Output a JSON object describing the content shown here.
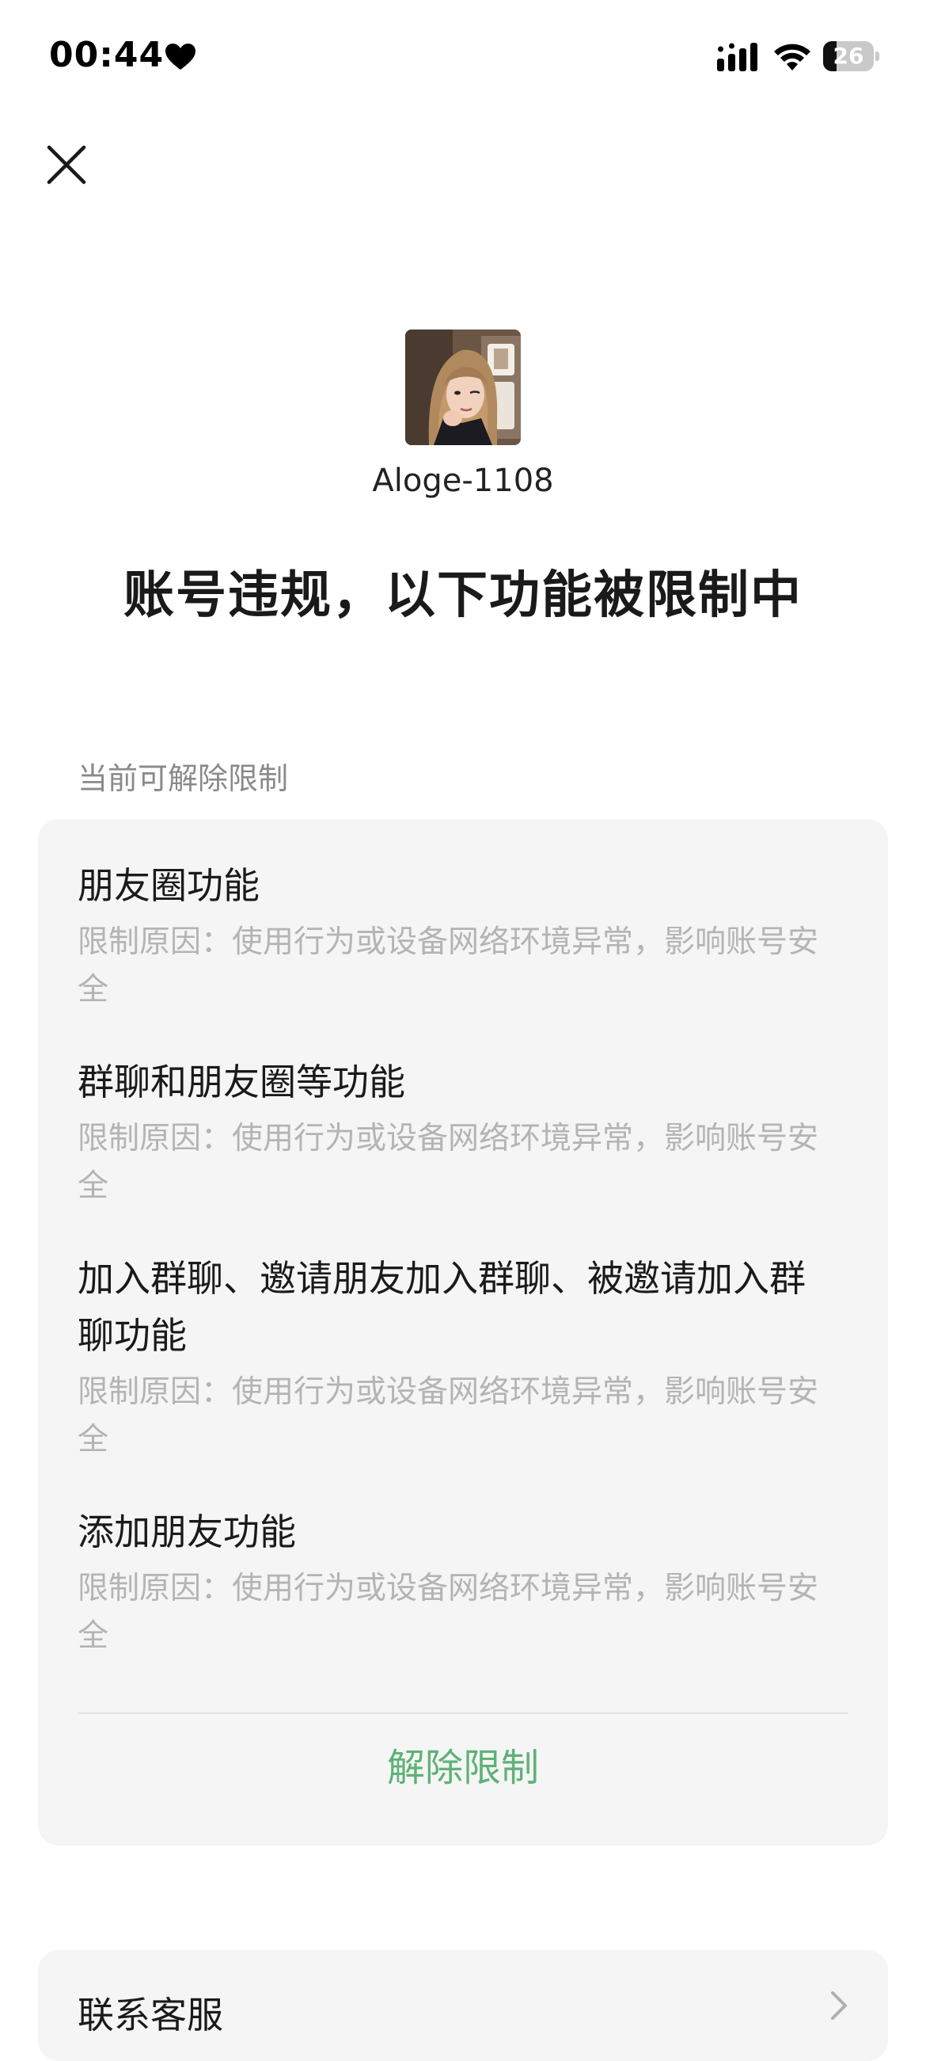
{
  "status_bar": {
    "time": "00:44",
    "battery": "26",
    "battery_level": 0.26
  },
  "header": {
    "username": "Aloge-1108",
    "title": "账号违规，以下功能被限制中"
  },
  "section": {
    "label": "当前可解除限制"
  },
  "restrictions": [
    {
      "title": "朋友圈功能",
      "reason": "限制原因：使用行为或设备网络环境异常，影响账号安全"
    },
    {
      "title": "群聊和朋友圈等功能",
      "reason": "限制原因：使用行为或设备网络环境异常，影响账号安全"
    },
    {
      "title": "加入群聊、邀请朋友加入群聊、被邀请加入群聊功能",
      "reason": "限制原因：使用行为或设备网络环境异常，影响账号安全"
    },
    {
      "title": "添加朋友功能",
      "reason": "限制原因：使用行为或设备网络环境异常，影响账号安全"
    }
  ],
  "actions": {
    "unlock_label": "解除限制",
    "contact_label": "联系客服"
  },
  "colors": {
    "accent_green": "#5eb276",
    "card_bg": "#f5f5f5",
    "secondary_text": "#b4b4b4"
  },
  "icons": {
    "close": "close-icon",
    "heart": "heart-icon",
    "signal": "cellular-signal-icon",
    "wifi": "wifi-icon",
    "battery": "battery-icon",
    "chevron": "chevron-right-icon"
  }
}
